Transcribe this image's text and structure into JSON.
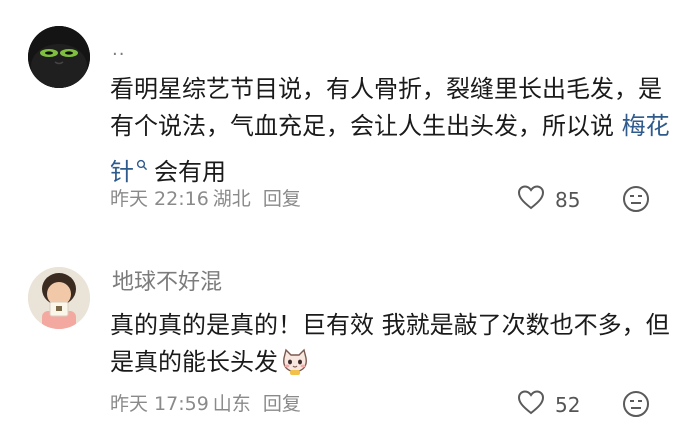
{
  "comments": [
    {
      "username": "..",
      "text_before_link": "看明星综艺节目说，有人骨折，裂缝里长出毛发，是有个说法，气血充足，会让人生出头发，所以说 ",
      "link": "梅花针",
      "text_after_link": "会有用",
      "time": "昨天 22:16",
      "location": "湖北",
      "reply": "回复",
      "likes": "85"
    },
    {
      "username": "地球不好混",
      "text": "真的真的是真的！巨有效 我就是敲了次数也不多，但是真的能长头发",
      "time": "昨天 17:59",
      "location": "山东",
      "reply": "回复",
      "likes": "52"
    }
  ]
}
